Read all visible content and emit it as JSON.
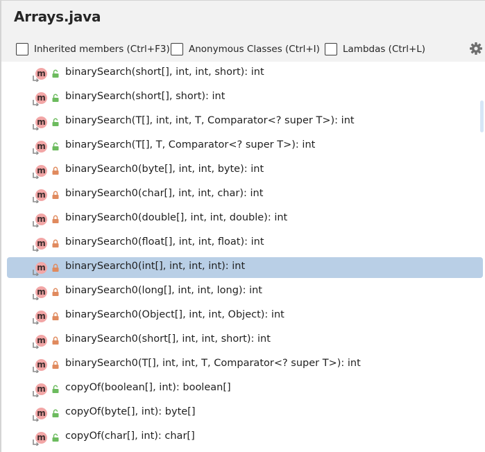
{
  "window": {
    "title": "Arrays.java"
  },
  "options": [
    {
      "label": "Inherited members (Ctrl+F3)",
      "checked": false
    },
    {
      "label": "Anonymous Classes (Ctrl+I)",
      "checked": false
    },
    {
      "label": "Lambdas (Ctrl+L)",
      "checked": false
    }
  ],
  "settings_icon": "gear-icon",
  "icons": {
    "method_letter": "m",
    "method_color": "#f2a6a6",
    "public_lock_color": "#6cbb5e",
    "private_lock_color": "#e08a5e",
    "selection_color": "#b9cfe6"
  },
  "members": [
    {
      "signature": "binarySearch(short[], int, int, short): int",
      "visibility": "public"
    },
    {
      "signature": "binarySearch(short[], short): int",
      "visibility": "public"
    },
    {
      "signature": "binarySearch(T[], int, int, T, Comparator<? super T>): int",
      "visibility": "public"
    },
    {
      "signature": "binarySearch(T[], T, Comparator<? super T>): int",
      "visibility": "public"
    },
    {
      "signature": "binarySearch0(byte[], int, int, byte): int",
      "visibility": "private"
    },
    {
      "signature": "binarySearch0(char[], int, int, char): int",
      "visibility": "private"
    },
    {
      "signature": "binarySearch0(double[], int, int, double): int",
      "visibility": "private"
    },
    {
      "signature": "binarySearch0(float[], int, int, float): int",
      "visibility": "private"
    },
    {
      "signature": "binarySearch0(int[], int, int, int): int",
      "visibility": "private",
      "selected": true
    },
    {
      "signature": "binarySearch0(long[], int, int, long): int",
      "visibility": "private"
    },
    {
      "signature": "binarySearch0(Object[], int, int, Object): int",
      "visibility": "private"
    },
    {
      "signature": "binarySearch0(short[], int, int, short): int",
      "visibility": "private"
    },
    {
      "signature": "binarySearch0(T[], int, int, T, Comparator<? super T>): int",
      "visibility": "private"
    },
    {
      "signature": "copyOf(boolean[], int): boolean[]",
      "visibility": "public"
    },
    {
      "signature": "copyOf(byte[], int): byte[]",
      "visibility": "public"
    },
    {
      "signature": "copyOf(char[], int): char[]",
      "visibility": "public"
    }
  ]
}
